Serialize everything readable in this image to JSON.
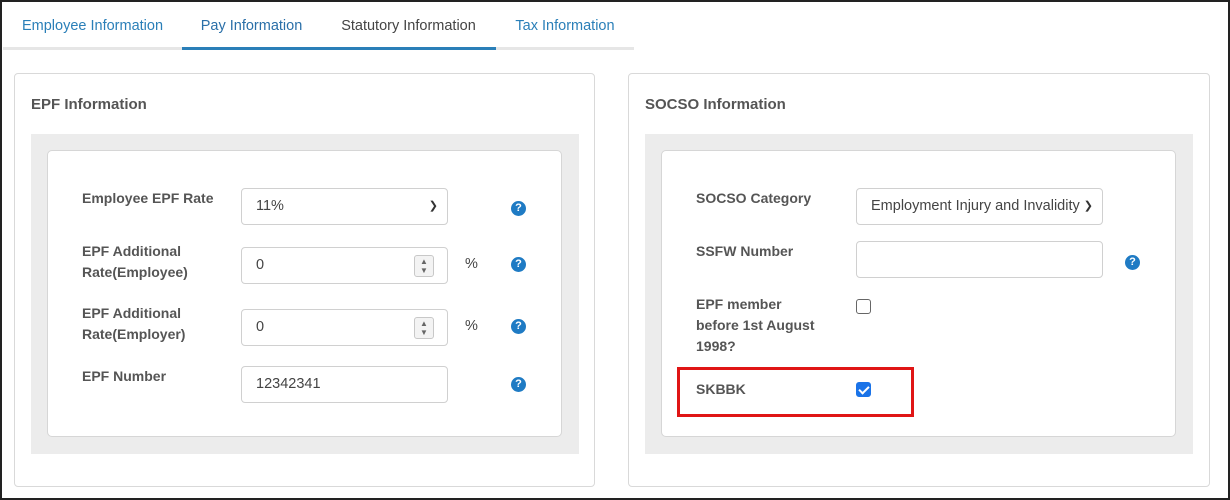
{
  "tabs": [
    {
      "label": "Employee Information"
    },
    {
      "label": "Pay Information"
    },
    {
      "label": "Statutory Information"
    },
    {
      "label": "Tax Information"
    }
  ],
  "epf": {
    "title": "EPF Information",
    "employee_rate_label": "Employee EPF Rate",
    "employee_rate_value": "11%",
    "additional_employee_label_1": "EPF Additional",
    "additional_employee_label_2": "Rate(Employee)",
    "additional_employee_value": "0",
    "additional_employer_label_1": "EPF Additional",
    "additional_employer_label_2": "Rate(Employer)",
    "additional_employer_value": "0",
    "percent_symbol": "%",
    "number_label": "EPF Number",
    "number_value": "12342341"
  },
  "socso": {
    "title": "SOCSO Information",
    "category_label": "SOCSO Category",
    "category_value": "Employment Injury and Invalidity",
    "ssfw_label": "SSFW Number",
    "ssfw_value": "",
    "epf_member_label_1": "EPF member",
    "epf_member_label_2": "before 1st August",
    "epf_member_label_3": "1998?",
    "epf_member_checked": false,
    "skbbk_label": "SKBBK",
    "skbbk_checked": true
  },
  "icons": {
    "help": "question-circle-icon",
    "chevron": "chevron-down-icon",
    "spinner": "spinner-arrows-icon"
  },
  "colors": {
    "accent": "#2a7fb8",
    "help_icon": "#1f7bc4",
    "checkbox_checked": "#1a73e8",
    "highlight": "#e01515"
  }
}
